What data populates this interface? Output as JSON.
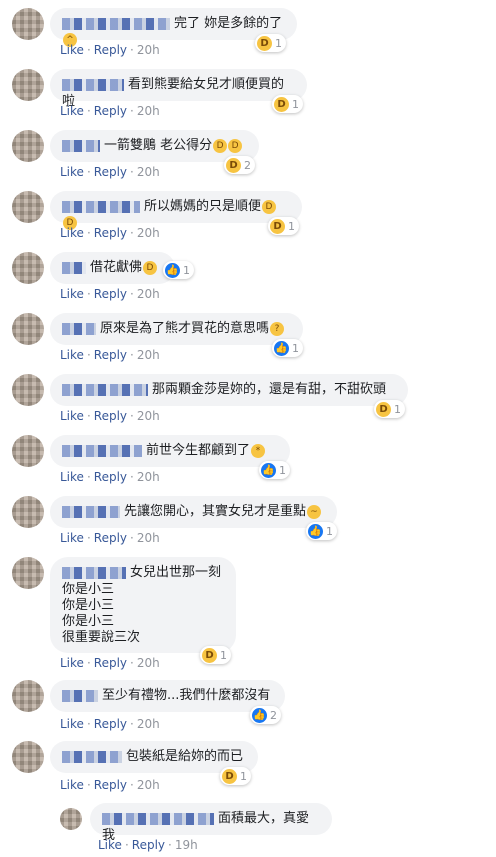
{
  "actions": {
    "like": "Like",
    "reply": "Reply",
    "separator": "·"
  },
  "comments": [
    {
      "text": "完了 妳是多餘的了",
      "emoji": "😆",
      "time": "20h",
      "reactions": {
        "type": "haha",
        "count": "1"
      }
    },
    {
      "text": "看到熊要給女兒才順便買的啦",
      "time": "20h",
      "reactions": {
        "type": "haha",
        "count": "1"
      }
    },
    {
      "text": "一箭雙鵰 老公得分",
      "emoji": "😂😂",
      "time": "20h",
      "reactions": {
        "type": "haha",
        "count": "2"
      }
    },
    {
      "text": "所以媽媽的只是順便",
      "emoji": "🤣🤣",
      "time": "20h",
      "reactions": {
        "type": "haha",
        "count": "1"
      }
    },
    {
      "text": "借花獻佛",
      "emoji": "🤣",
      "time": "20h",
      "reactions": {
        "type": "like",
        "count": "1"
      }
    },
    {
      "text": "原來是為了熊才買花的意思嗎",
      "emoji": "🤔",
      "time": "20h",
      "reactions": {
        "type": "like",
        "count": "1"
      }
    },
    {
      "text": "那兩顆金莎是妳的，還是有甜，不甜砍頭",
      "time": "20h",
      "reactions": {
        "type": "haha",
        "count": "1"
      }
    },
    {
      "text": "前世今生都顧到了",
      "emoji": "👏",
      "time": "20h",
      "reactions": {
        "type": "like",
        "count": "1"
      }
    },
    {
      "text": "先讓您開心，其實女兒才是重點",
      "emoji": "😏",
      "time": "20h",
      "reactions": {
        "type": "like",
        "count": "1"
      }
    },
    {
      "text": "女兒出世那一刻",
      "lines": [
        "你是小三",
        "你是小三",
        "你是小三",
        "很重要說三次"
      ],
      "time": "20h",
      "reactions": {
        "type": "haha",
        "count": "1"
      }
    },
    {
      "text": "至少有禮物...我們什麼都沒有",
      "time": "20h",
      "reactions": {
        "type": "like",
        "count": "2"
      }
    },
    {
      "text": "包裝紙是給妳的而已",
      "time": "20h",
      "reactions": {
        "type": "haha",
        "count": "1"
      }
    },
    {
      "text": "面積最大，真愛我",
      "time": "19h"
    }
  ],
  "icons": {
    "haha": "haha-reaction-icon",
    "like": "like-reaction-icon"
  },
  "colors": {
    "link": "#385898",
    "meta": "#90949c",
    "bubble": "#f2f3f5",
    "like": "#1877f2",
    "haha": "#f7c442"
  }
}
